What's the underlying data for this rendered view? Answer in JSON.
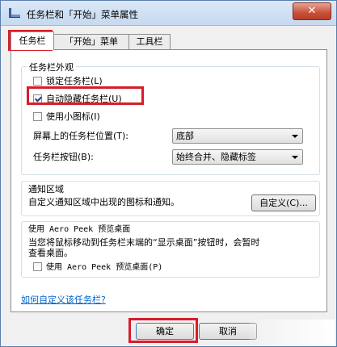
{
  "window": {
    "title": "任务栏和「开始」菜单属性",
    "close_label": "✕"
  },
  "tabs": [
    {
      "label": "任务栏",
      "active": true
    },
    {
      "label": "「开始」菜单",
      "active": false
    },
    {
      "label": "工具栏",
      "active": false
    }
  ],
  "appearance": {
    "title": "任务栏外观",
    "lock_label": "锁定任务栏(L)",
    "lock_checked": false,
    "autohide_label": "自动隐藏任务栏(U)",
    "autohide_checked": true,
    "small_icons_label": "使用小图标(I)",
    "small_icons_checked": false,
    "position_label": "屏幕上的任务栏位置(T):",
    "position_value": "底部",
    "buttons_label": "任务栏按钮(B):",
    "buttons_value": "始终合并、隐藏标签"
  },
  "notification": {
    "title": "通知区域",
    "desc": "自定义通知区域中出现的图标和通知。",
    "customize_label": "自定义(C)..."
  },
  "aero_peek": {
    "title": "使用 Aero Peek 预览桌面",
    "desc_line1": "当您将鼠标移动到任务栏末端的“显示桌面”按钮时，会暂时",
    "desc_line2": "查看桌面。",
    "checkbox_label": "使用 Aero Peek 预览桌面(P)",
    "checked": false
  },
  "help_link": "如何自定义该任务栏?",
  "footer": {
    "ok_label": "确定",
    "cancel_label": "取消"
  },
  "colors": {
    "highlight": "#d71d2a",
    "link": "#0066cc"
  }
}
